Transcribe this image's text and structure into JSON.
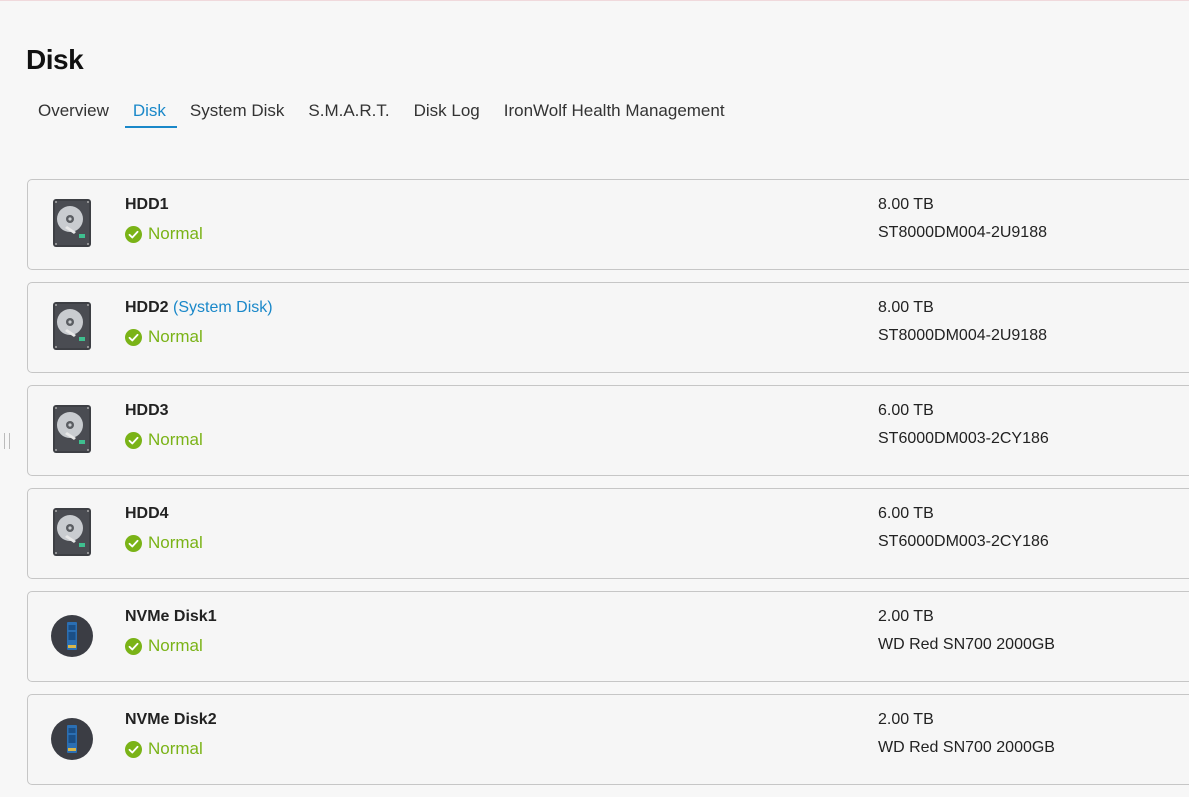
{
  "page": {
    "title": "Disk"
  },
  "tabs": [
    {
      "label": "Overview"
    },
    {
      "label": "Disk"
    },
    {
      "label": "System Disk"
    },
    {
      "label": "S.M.A.R.T."
    },
    {
      "label": "Disk Log"
    },
    {
      "label": "IronWolf Health Management"
    }
  ],
  "active_tab": "Disk",
  "disks": [
    {
      "name": "HDD1",
      "tag": "",
      "status": "Normal",
      "capacity": "8.00 TB",
      "model": "ST8000DM004-2U9188",
      "icon": "hdd-icon"
    },
    {
      "name": "HDD2",
      "tag": "(System Disk)",
      "status": "Normal",
      "capacity": "8.00 TB",
      "model": "ST8000DM004-2U9188",
      "icon": "hdd-icon"
    },
    {
      "name": "HDD3",
      "tag": "",
      "status": "Normal",
      "capacity": "6.00 TB",
      "model": "ST6000DM003-2CY186",
      "icon": "hdd-icon"
    },
    {
      "name": "HDD4",
      "tag": "",
      "status": "Normal",
      "capacity": "6.00 TB",
      "model": "ST6000DM003-2CY186",
      "icon": "hdd-icon"
    },
    {
      "name": "NVMe Disk1",
      "tag": "",
      "status": "Normal",
      "capacity": "2.00 TB",
      "model": "WD Red SN700 2000GB",
      "icon": "nvme-icon"
    },
    {
      "name": "NVMe Disk2",
      "tag": "",
      "status": "Normal",
      "capacity": "2.00 TB",
      "model": "WD Red SN700 2000GB",
      "icon": "nvme-icon"
    }
  ],
  "colors": {
    "accent": "#1a88c9",
    "status_ok": "#7ab317"
  }
}
